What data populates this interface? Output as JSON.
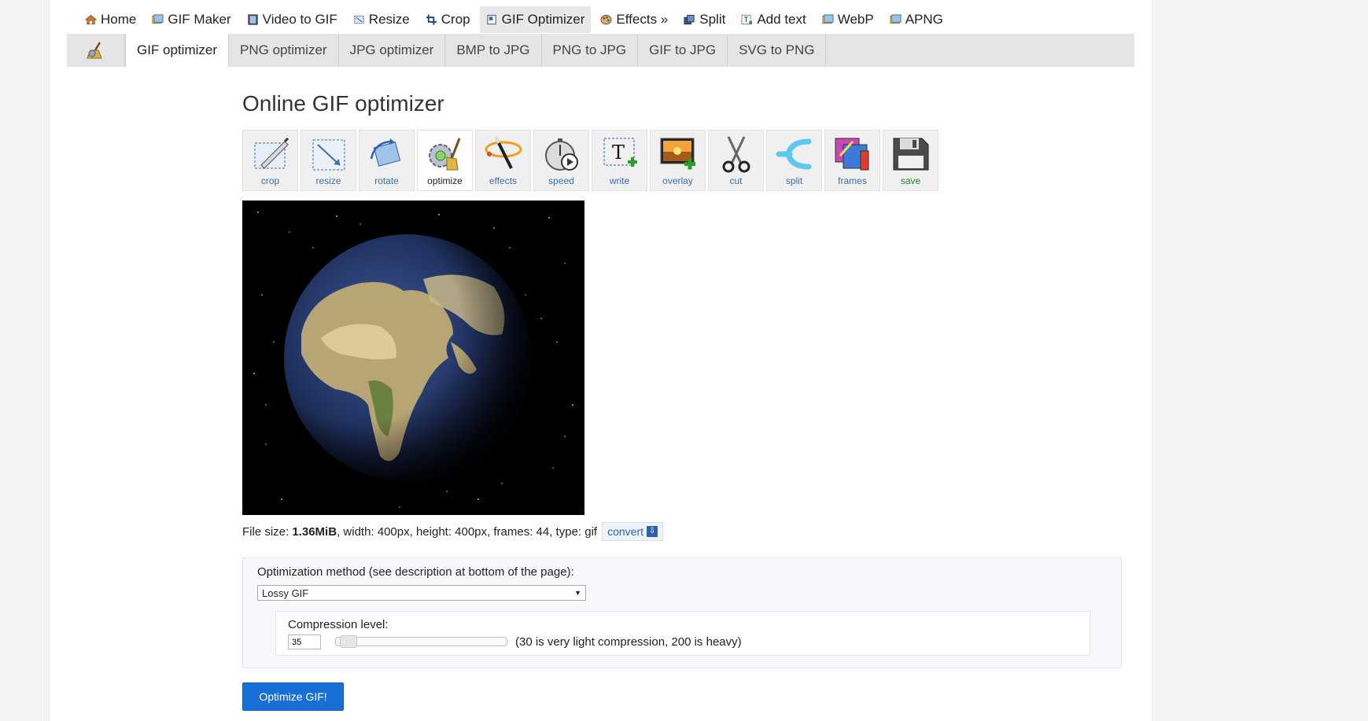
{
  "topnav": {
    "items": [
      {
        "label": "Home",
        "icon": "home-icon"
      },
      {
        "label": "GIF Maker",
        "icon": "gif-maker-icon"
      },
      {
        "label": "Video to GIF",
        "icon": "video-icon"
      },
      {
        "label": "Resize",
        "icon": "resize-icon"
      },
      {
        "label": "Crop",
        "icon": "crop-icon"
      },
      {
        "label": "GIF Optimizer",
        "icon": "optimizer-icon"
      },
      {
        "label": "Effects »",
        "icon": "effects-icon"
      },
      {
        "label": "Split",
        "icon": "split-icon"
      },
      {
        "label": "Add text",
        "icon": "text-icon"
      },
      {
        "label": "WebP",
        "icon": "webp-icon"
      },
      {
        "label": "APNG",
        "icon": "apng-icon"
      }
    ],
    "active": "GIF Optimizer"
  },
  "subnav": {
    "tabs": [
      "GIF optimizer",
      "PNG optimizer",
      "JPG optimizer",
      "BMP to JPG",
      "PNG to JPG",
      "GIF to JPG",
      "SVG to PNG"
    ],
    "active": "GIF optimizer"
  },
  "page_title": "Online GIF optimizer",
  "toolbar": {
    "tools": [
      "crop",
      "resize",
      "rotate",
      "optimize",
      "effects",
      "speed",
      "write",
      "overlay",
      "cut",
      "split",
      "frames",
      "save"
    ],
    "active": "optimize"
  },
  "file_info": {
    "size_label": "File size: ",
    "size_value": "1.36MiB",
    "rest": ", width: 400px, height: 400px, frames: 44, type: gif",
    "convert_label": "convert"
  },
  "options": {
    "method_label": "Optimization method (see description at bottom of the page):",
    "method_selected": "Lossy GIF",
    "compression_label": "Compression level:",
    "compression_value": "35",
    "compression_min": 30,
    "compression_max": 200,
    "compression_hint": "(30 is very light compression, 200 is heavy)"
  },
  "submit_label": "Optimize GIF!",
  "colors": {
    "accent": "#1a6fd6",
    "link": "#3a6ea5",
    "save": "#2a7d2a"
  }
}
